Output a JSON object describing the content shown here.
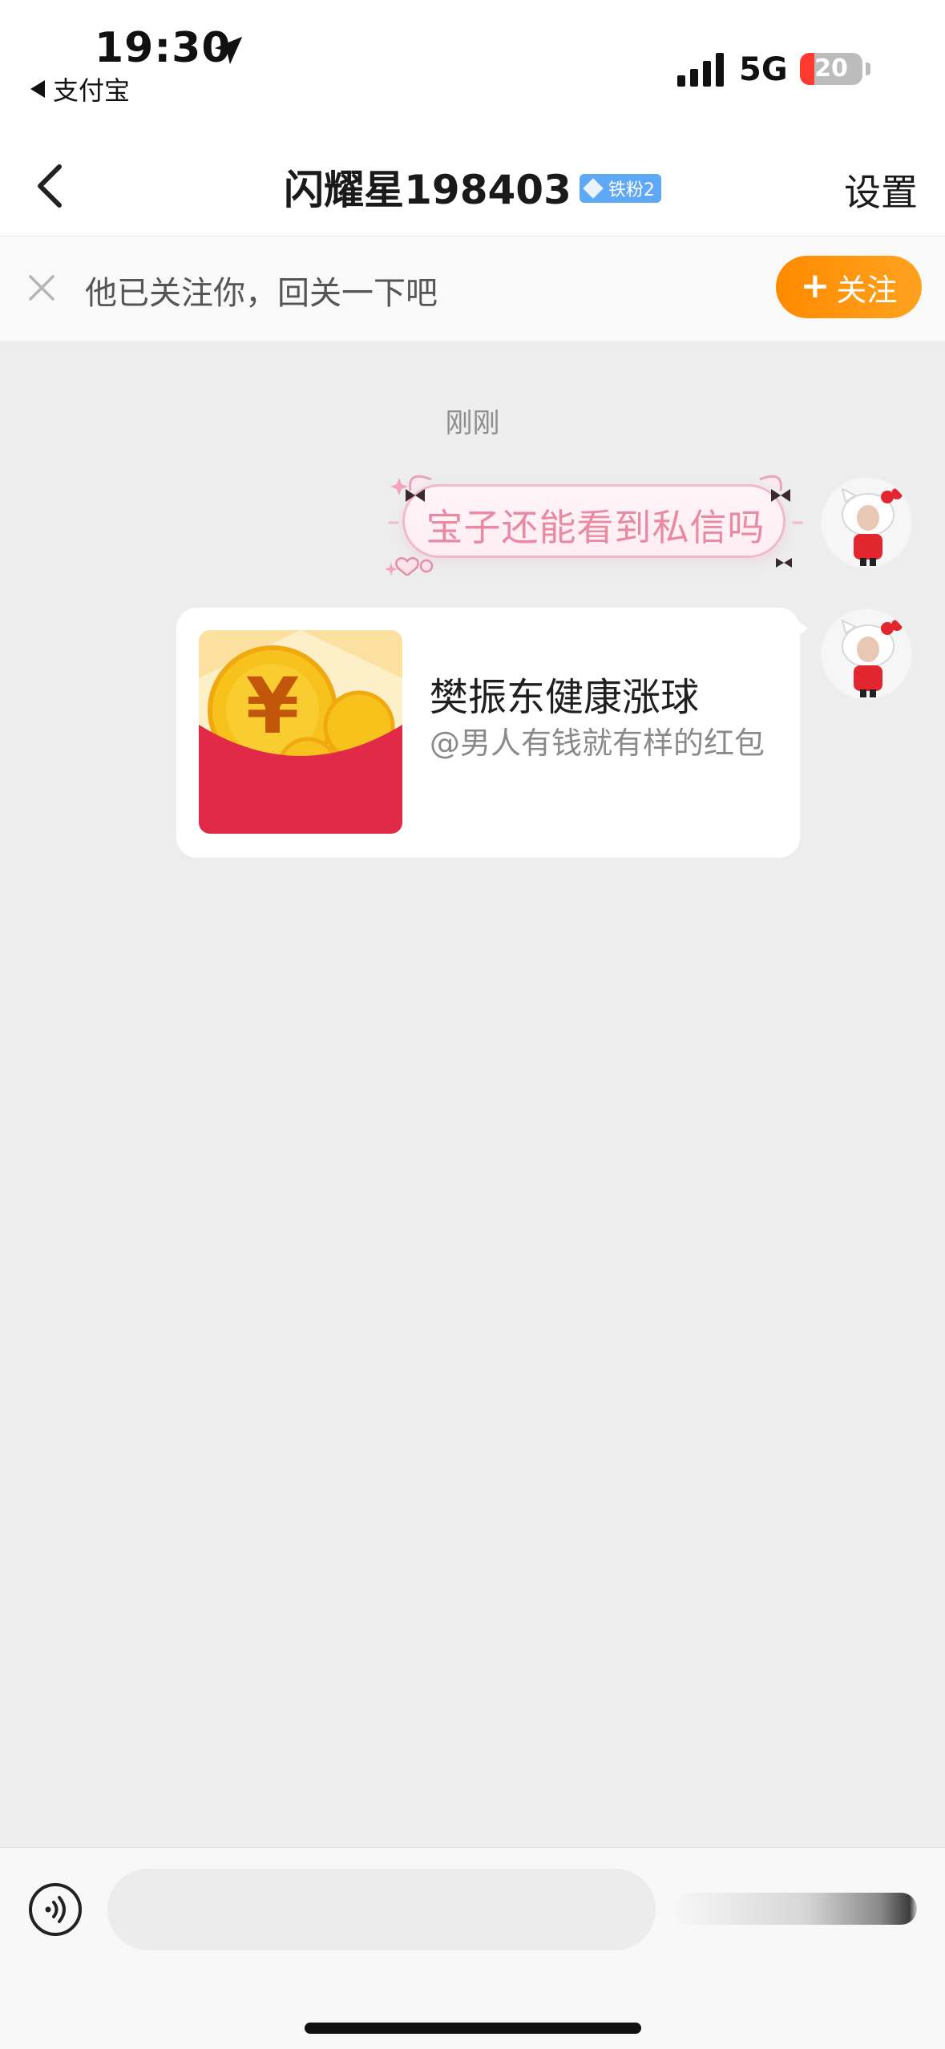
{
  "status_bar": {
    "time": "19:30",
    "back_app": "支付宝",
    "network": "5G",
    "battery": "20",
    "icons": [
      "location-arrow-icon",
      "signal-bars-icon",
      "battery-icon"
    ]
  },
  "nav": {
    "title": "闪耀星198403",
    "fan_badge": "铁粉2",
    "settings": "设置",
    "back_icon": "chevron-left-icon"
  },
  "follow_bar": {
    "text": "他已关注你，回关一下吧",
    "button_plus": "+",
    "button_label": "关注",
    "close_icon": "close-icon"
  },
  "chat": {
    "timestamp": "刚刚",
    "messages": [
      {
        "type": "text",
        "text": "宝子还能看到私信吗"
      },
      {
        "type": "red_packet",
        "title": "樊振东健康涨球",
        "subtitle": "@男人有钱就有样的红包"
      }
    ]
  },
  "input_bar": {
    "placeholder": "",
    "voice_icon": "voice-icon"
  },
  "colors": {
    "accent_orange": "#ff8a00",
    "badge_blue": "#5fa8f5",
    "bubble_pink": "#e98aa4",
    "red_packet": "#e02a48",
    "coin_gold": "#f7c21b"
  }
}
